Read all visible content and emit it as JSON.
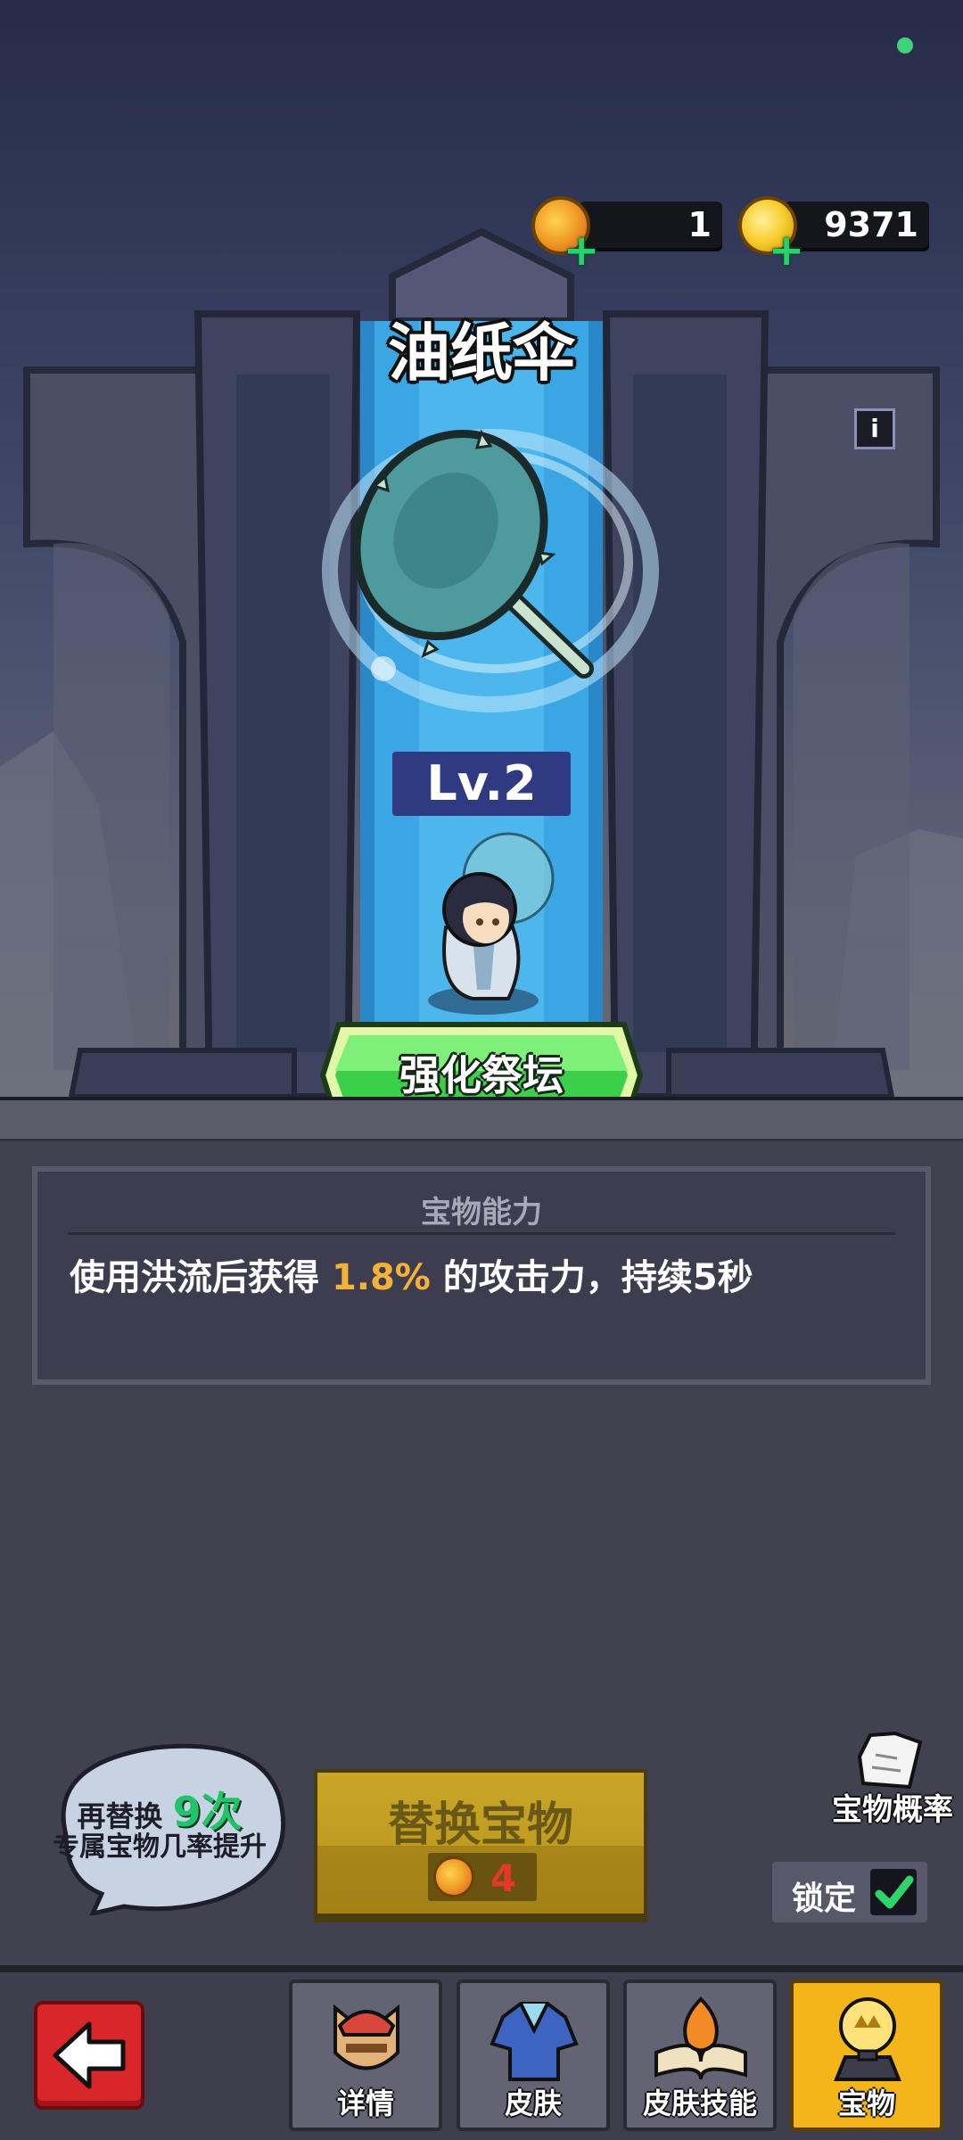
{
  "currency": {
    "gems": {
      "icon": "orange-orb-icon",
      "value": "1"
    },
    "gold": {
      "icon": "gold-coin-icon",
      "value": "9371"
    }
  },
  "treasure": {
    "name": "油纸伞",
    "info_icon": "i",
    "level": "Lv.2",
    "enhance_button": "强化祭坛"
  },
  "ability": {
    "title": "宝物能力",
    "text_before": "使用洪流后获得 ",
    "highlight": "1.8%",
    "text_after": " 的攻击力，持续5秒",
    "highlight_color": "#f4b23a"
  },
  "bubble": {
    "prefix": "再替换",
    "count": "9次",
    "line2": "专属宝物几率提升"
  },
  "replace": {
    "label": "替换宝物",
    "cost": "4"
  },
  "probability_label": "宝物概率",
  "lock": {
    "label": "锁定",
    "checked": true
  },
  "nav": {
    "tabs": [
      {
        "label": "详情",
        "icon": "knight-helmet-icon"
      },
      {
        "label": "皮肤",
        "icon": "robe-icon"
      },
      {
        "label": "皮肤技能",
        "icon": "spellbook-icon"
      },
      {
        "label": "宝物",
        "icon": "treasure-trophy-icon",
        "active": true
      }
    ]
  },
  "colors": {
    "accent_green": "#24d36b",
    "active_tab": "#f4b51a",
    "back_button": "#d8262b"
  }
}
